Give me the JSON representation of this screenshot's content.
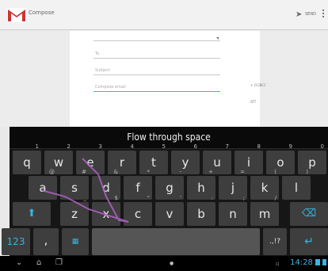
{
  "action_bar": {
    "title": "Compose",
    "send_label": "SEND",
    "logo_letter": "M",
    "brand_color": "#cc3333"
  },
  "compose": {
    "to_placeholder": "To",
    "subject_placeholder": "Subject",
    "body_placeholder": "Compose email",
    "cc_label": "+ CC/BCC",
    "attach_label": "ATT"
  },
  "keyboard": {
    "suggestion": "Flow through space",
    "accent_color": "#33b5e5",
    "rows": [
      [
        {
          "k": "q",
          "h": "1"
        },
        {
          "k": "w",
          "h": "2"
        },
        {
          "k": "e",
          "h": "3"
        },
        {
          "k": "r",
          "h": "4"
        },
        {
          "k": "t",
          "h": "5"
        },
        {
          "k": "y",
          "h": "6"
        },
        {
          "k": "u",
          "h": "7"
        },
        {
          "k": "i",
          "h": "8"
        },
        {
          "k": "o",
          "h": "9"
        },
        {
          "k": "p",
          "h": "0"
        }
      ],
      [
        {
          "k": "a",
          "h": "@"
        },
        {
          "k": "s",
          "h": "#"
        },
        {
          "k": "d",
          "h": "&"
        },
        {
          "k": "f",
          "h": "*"
        },
        {
          "k": "g",
          "h": "-"
        },
        {
          "k": "h",
          "h": "+"
        },
        {
          "k": "j",
          "h": "="
        },
        {
          "k": "k",
          "h": "("
        },
        {
          "k": "l",
          "h": ")"
        }
      ],
      [
        {
          "k": "z",
          "h": "_"
        },
        {
          "k": "x",
          "h": "$"
        },
        {
          "k": "c",
          "h": "\""
        },
        {
          "k": "v",
          "h": "'"
        },
        {
          "k": "b",
          "h": ":"
        },
        {
          "k": "n",
          "h": ";"
        },
        {
          "k": "m",
          "h": "/"
        }
      ]
    ],
    "bottom": {
      "numeric_label": "123",
      "comma_label": ",",
      "punct_label": ".,!?"
    }
  },
  "status": {
    "clock": "14:28"
  }
}
